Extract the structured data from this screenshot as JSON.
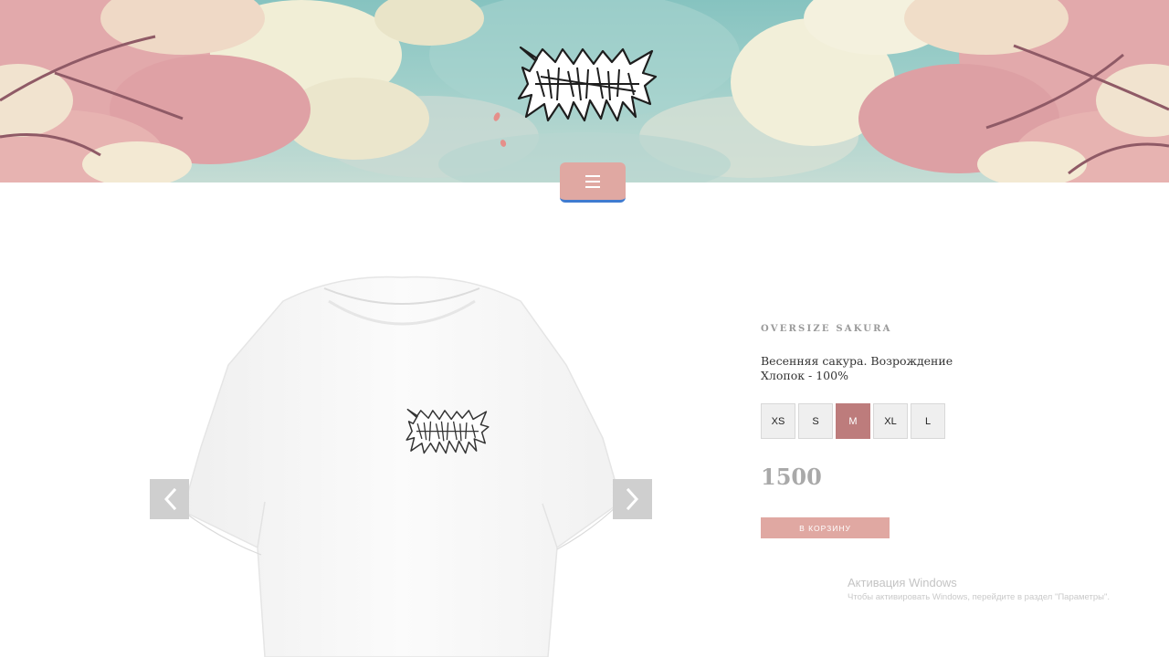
{
  "header": {
    "brand_logo": "brand-logo",
    "menu_icon": "hamburger-icon"
  },
  "gallery": {
    "prev_icon": "chevron-left-icon",
    "next_icon": "chevron-right-icon"
  },
  "product": {
    "name": "OVERSIZE SAKURA",
    "description_line1": "Весенняя сакура. Возрождение",
    "description_line2": "Хлопок - 100%",
    "sizes": [
      {
        "label": "XS",
        "selected": false
      },
      {
        "label": "S",
        "selected": false
      },
      {
        "label": "M",
        "selected": true
      },
      {
        "label": "XL",
        "selected": false
      },
      {
        "label": "L",
        "selected": false
      }
    ],
    "price": "1500",
    "cart_button": "В КОРЗИНУ"
  },
  "windows_watermark": {
    "title": "Активация Windows",
    "subtitle": "Чтобы активировать Windows, перейдите в раздел \"Параметры\"."
  },
  "colors": {
    "accent_pink": "#e0a8a2",
    "selected_size": "#bd7c7c",
    "menu_underline": "#3f7bd0",
    "sky_teal": "#86c3c0"
  }
}
